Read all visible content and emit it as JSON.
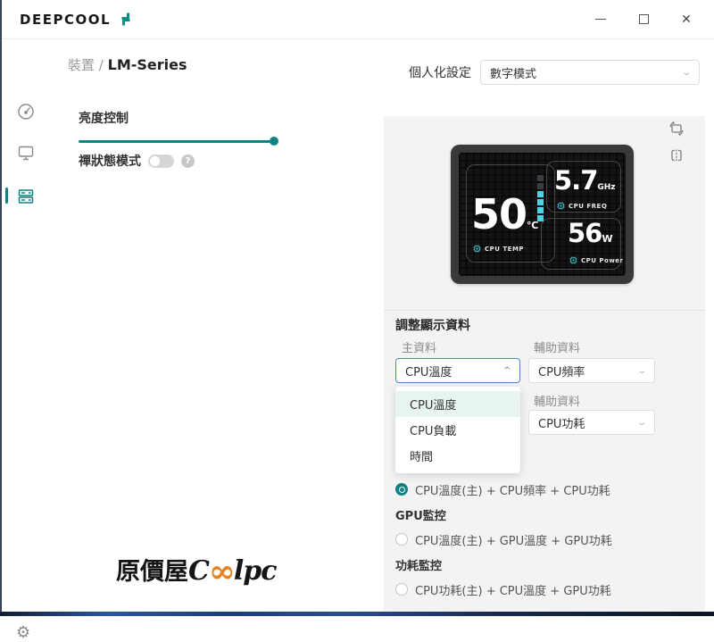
{
  "colors": {
    "accent_teal": "#0d8282",
    "screen_cyan": "#4fd4e4",
    "screen_gray_segment": "#3c3c40",
    "focus_blue": "#4a86c8",
    "panel_bg": "#f3f3f3",
    "selected_item_bg": "#e7f4f0",
    "watermark_orange": "#e8821e"
  },
  "window": {
    "logo_text": "DeepCool",
    "controls": {
      "minimize": "minimize",
      "maximize": "maximize",
      "close": "✕"
    }
  },
  "sidebar": {
    "items": [
      {
        "name": "dashboard",
        "icon": "gauge-icon",
        "active": false
      },
      {
        "name": "display",
        "icon": "monitor-icon",
        "active": false
      },
      {
        "name": "devices",
        "icon": "device-icon",
        "active": true
      },
      {
        "name": "settings",
        "icon": "gear-icon",
        "active": false
      }
    ]
  },
  "breadcrumb": {
    "section": "裝置",
    "separator": "/",
    "page": "LM-Series"
  },
  "personalization": {
    "label": "個人化設定",
    "value": "數字模式"
  },
  "brightness": {
    "label": "亮度控制",
    "value_pct": 100
  },
  "zen": {
    "label": "禪狀態模式",
    "state": "off",
    "help": "?"
  },
  "preview": {
    "tools": [
      {
        "icon": "rotate-icon"
      },
      {
        "icon": "flip-icon"
      }
    ],
    "screen": {
      "temp": {
        "value": "50",
        "unit": "℃",
        "label": "CPU TEMP"
      },
      "freq": {
        "value": "5.7",
        "unit": "GHz",
        "label": "CPU FREQ"
      },
      "power": {
        "value": "56",
        "unit": "W",
        "label": "CPU Power"
      },
      "meter": {
        "segments": 6,
        "active": 4
      }
    }
  },
  "adjust": {
    "title": "調整顯示資料",
    "primary": {
      "label": "主資料",
      "value": "CPU溫度",
      "open": true,
      "options": [
        "CPU溫度",
        "CPU負載",
        "時間"
      ],
      "selected_index": 0
    },
    "aux1": {
      "label": "輔助資料",
      "value": "CPU頻率"
    },
    "aux2": {
      "label": "輔助資料",
      "value": "CPU功耗"
    },
    "presets": [
      {
        "type": "radio",
        "label": "CPU溫度(主) + CPU頻率 + CPU功耗",
        "checked": true
      },
      {
        "type": "header",
        "label": "GPU監控"
      },
      {
        "type": "radio",
        "label": "CPU溫度(主) + GPU溫度 + GPU功耗",
        "checked": false
      },
      {
        "type": "header",
        "label": "功耗監控"
      },
      {
        "type": "radio",
        "label": "CPU功耗(主) + CPU溫度 + GPU功耗",
        "checked": false
      }
    ]
  },
  "watermark": {
    "prefix": "原價屋",
    "c": "C",
    "infinity": "∞",
    "suffix": "lpc"
  }
}
